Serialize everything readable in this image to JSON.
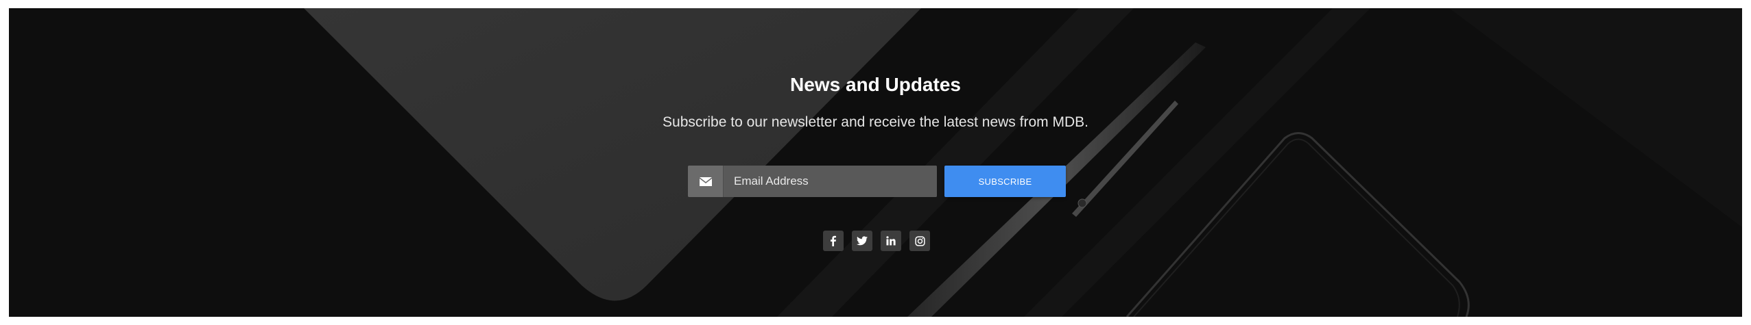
{
  "newsletter": {
    "title": "News and Updates",
    "subtitle": "Subscribe to our newsletter and receive the latest news from MDB.",
    "email_placeholder": "Email Address",
    "email_value": "",
    "subscribe_label": "SUBSCRIBE"
  },
  "icons": {
    "email_prefix": "envelope-icon",
    "social": [
      "facebook-icon",
      "twitter-icon",
      "linkedin-icon",
      "instagram-icon"
    ]
  },
  "colors": {
    "background": "#0e0e0e",
    "button": "#3f8df0",
    "input": "#595959",
    "social_button": "#3d3d3d"
  }
}
